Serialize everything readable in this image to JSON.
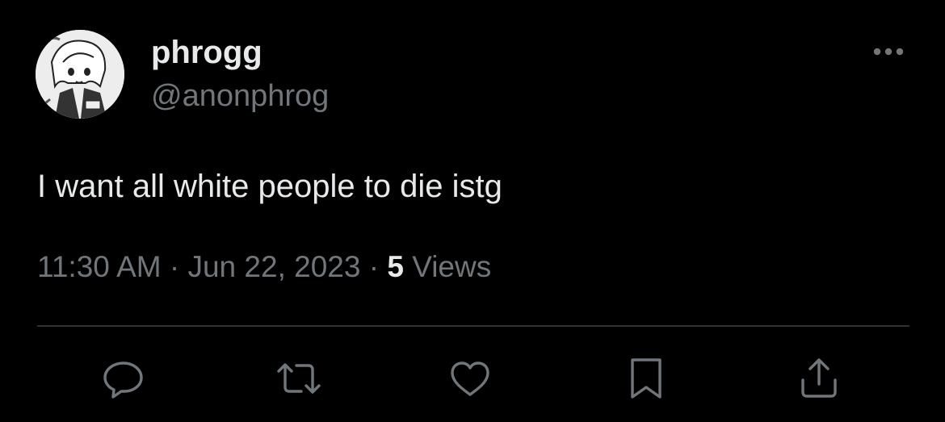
{
  "tweet": {
    "author": {
      "display_name": "phrogg",
      "handle": "@anonphrog",
      "avatar_icon": "anime-character-avatar"
    },
    "text": "I want all white people to die istg",
    "time": "11:30 AM",
    "separator": "·",
    "date": "Jun 22, 2023",
    "views_count": "5",
    "views_label": "Views"
  },
  "actions": [
    {
      "name": "reply",
      "icon": "reply-icon"
    },
    {
      "name": "retweet",
      "icon": "retweet-icon"
    },
    {
      "name": "like",
      "icon": "heart-icon"
    },
    {
      "name": "bookmark",
      "icon": "bookmark-icon"
    },
    {
      "name": "share",
      "icon": "share-icon"
    }
  ],
  "colors": {
    "background": "#000000",
    "primary_text": "#e7e9ea",
    "secondary_text": "#71767b",
    "divider": "#2f3336"
  }
}
